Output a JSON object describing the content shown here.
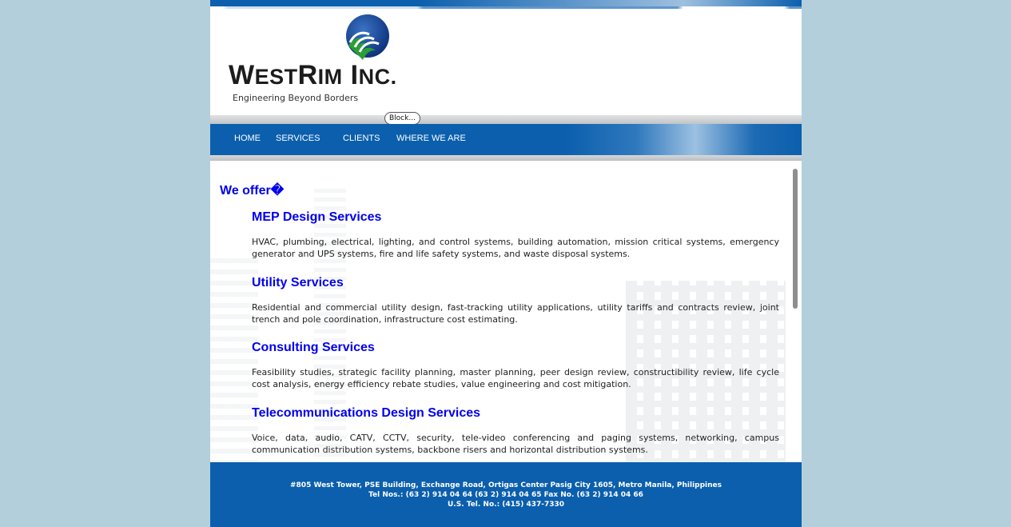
{
  "header": {
    "company_name_part1": "W",
    "company_name_part1_small": "EST",
    "company_name_part2": "R",
    "company_name_part2_small": "IM",
    "company_name_part3": " I",
    "company_name_part3_small": "NC.",
    "tagline": "Engineering Beyond Borders",
    "block_tag": "Block..."
  },
  "nav": {
    "items": [
      {
        "label": "HOME"
      },
      {
        "label": "SERVICES"
      },
      {
        "label": "CLIENTS"
      },
      {
        "label": "WHERE WE ARE"
      }
    ]
  },
  "content": {
    "heading": "We offer�",
    "services": [
      {
        "title": "MEP Design Services",
        "description": "HVAC, plumbing, electrical, lighting, and control systems, building automation, mission critical systems, emergency generator and UPS systems, fire and life safety systems, and waste disposal systems."
      },
      {
        "title": "Utility Services",
        "description": "Residential and commercial utility design, fast-tracking utility applications, utility tariffs and contracts review, joint trench and pole coordination, infrastructure cost estimating."
      },
      {
        "title": "Consulting Services",
        "description": "Feasibility studies, strategic facility planning, master planning, peer design review, constructibility review, life cycle cost analysis, energy efficiency rebate studies, value engineering and cost mitigation."
      },
      {
        "title": "Telecommunications Design Services",
        "description": "Voice, data, audio, CATV, CCTV, security, tele-video conferencing and paging systems, networking, campus communication distribution systems, backbone risers and horizontal distribution systems."
      }
    ]
  },
  "footer": {
    "address": "#805 West Tower, PSE Building, Exchange Road, Ortigas Center Pasig City 1605, Metro Manila, Philippines",
    "tel": "Tel Nos.: (63 2) 914 04 64 (63 2) 914 04 65 Fax No. (63 2) 914 04 66",
    "us_tel": "U.S. Tel. No.: (415) 437-7330"
  },
  "colors": {
    "brand_blue": "#0b5fad",
    "link_blue": "#0000ee",
    "page_background": "#b4cfdc"
  },
  "icons": {
    "logo": "globe-logo-icon"
  }
}
